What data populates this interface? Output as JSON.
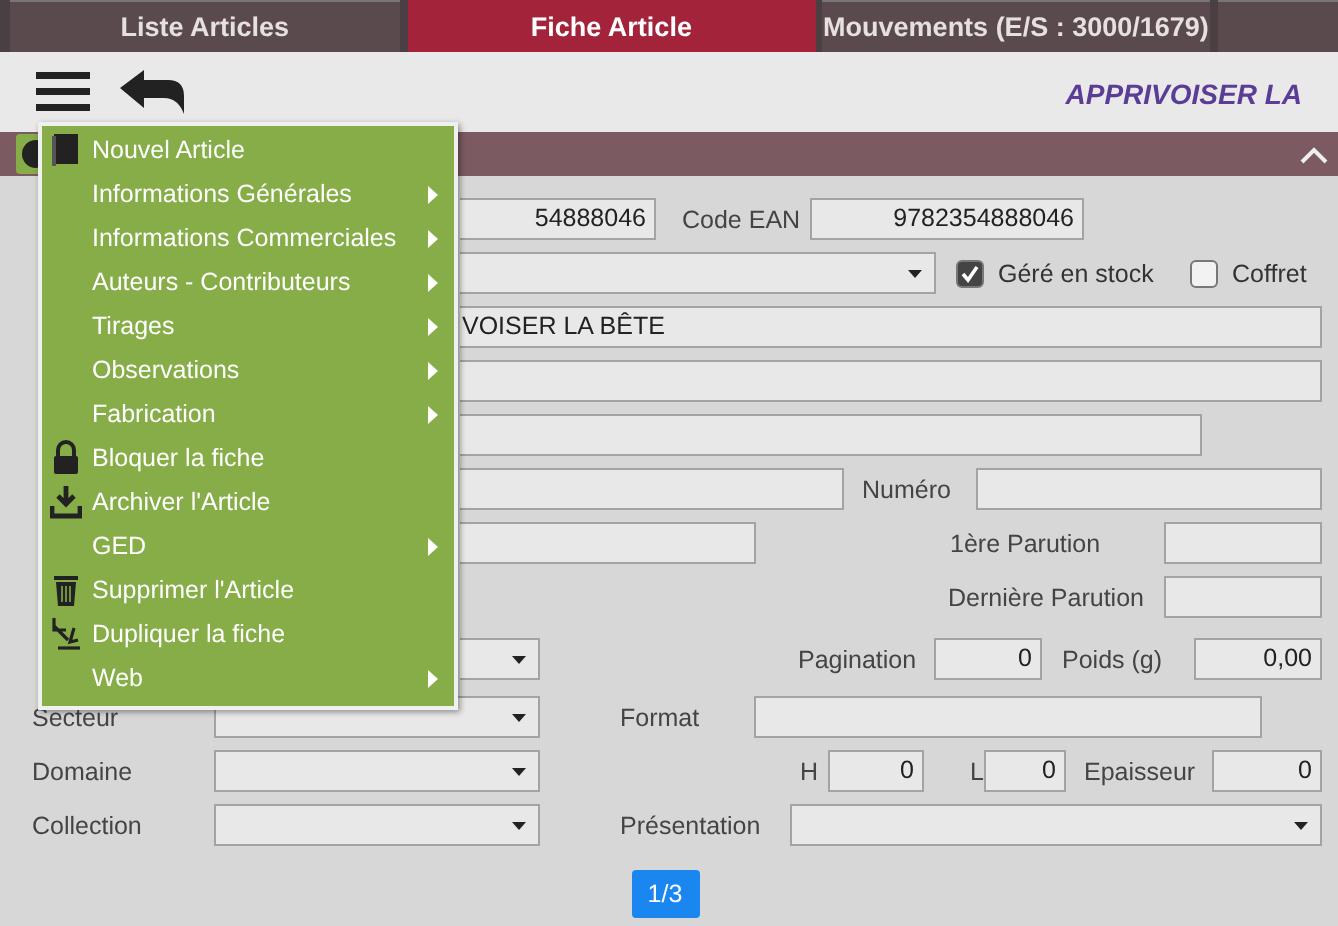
{
  "tabs": [
    {
      "label": "Liste Articles",
      "selected": false
    },
    {
      "label": "Fiche Article",
      "selected": true
    },
    {
      "label": "Mouvements (E/S : 3000/1679)",
      "selected": false
    },
    {
      "selected": false
    }
  ],
  "title": "APPRIVOISER LA",
  "menu": {
    "items": [
      {
        "label": "Nouvel Article",
        "kind": "book",
        "submenu": false
      },
      {
        "label": "Informations Générales",
        "kind": "plain",
        "submenu": true
      },
      {
        "label": "Informations Commerciales",
        "kind": "plain",
        "submenu": true
      },
      {
        "label": "Auteurs - Contributeurs",
        "kind": "plain",
        "submenu": true
      },
      {
        "label": "Tirages",
        "kind": "plain",
        "submenu": true
      },
      {
        "label": "Observations",
        "kind": "plain",
        "submenu": true
      },
      {
        "label": "Fabrication",
        "kind": "plain",
        "submenu": true
      },
      {
        "label": "Bloquer la fiche",
        "kind": "lock",
        "submenu": false
      },
      {
        "label": "Archiver l'Article",
        "kind": "download",
        "submenu": false
      },
      {
        "label": "GED",
        "kind": "plain",
        "submenu": true
      },
      {
        "label": "Supprimer l'Article",
        "kind": "trash",
        "submenu": false
      },
      {
        "label": "Dupliquer la fiche",
        "kind": "duplicate",
        "submenu": false
      },
      {
        "label": "Web",
        "kind": "plain",
        "submenu": true
      }
    ]
  },
  "form": {
    "rows": [
      [
        {
          "kind": "field",
          "value": "54888046"
        },
        {
          "kind": "field",
          "label": "Code EAN",
          "value": "9782354888046"
        }
      ],
      [
        {
          "kind": "select"
        },
        {
          "kind": "checkbox",
          "label": "Géré en stock",
          "checked": true
        },
        {
          "kind": "checkbox",
          "label": "Coffret",
          "checked": false
        }
      ],
      [
        {
          "kind": "field",
          "value": "VOISER LA BÊTE"
        }
      ],
      [
        {
          "kind": "field"
        }
      ],
      [
        {
          "kind": "field"
        }
      ],
      [
        {
          "kind": "field"
        },
        {
          "kind": "field",
          "label": "Numéro"
        }
      ],
      [
        {
          "kind": "field"
        },
        {
          "kind": "field",
          "label": "1ère Parution"
        }
      ],
      [
        {
          "kind": "field",
          "label": "Dernière Parution"
        }
      ],
      [
        {
          "kind": "select"
        },
        {
          "kind": "field",
          "label": "Pagination",
          "value": "0"
        },
        {
          "kind": "field",
          "label": "Poids (g)",
          "value": "0,00"
        }
      ],
      [
        {
          "kind": "select",
          "label": "Secteur"
        },
        {
          "kind": "field",
          "label": "Format"
        }
      ],
      [
        {
          "kind": "select",
          "label": "Domaine"
        },
        {
          "kind": "field",
          "label": "H",
          "value": "0"
        },
        {
          "kind": "field",
          "label": "L",
          "value": "0"
        },
        {
          "kind": "field",
          "label": "Epaisseur",
          "value": "0"
        }
      ],
      [
        {
          "kind": "select",
          "label": "Collection"
        },
        {
          "kind": "select",
          "label": "Présentation"
        }
      ]
    ]
  },
  "pager": "1/3"
}
